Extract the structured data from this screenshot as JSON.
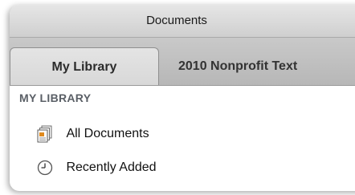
{
  "window": {
    "title": "Documents"
  },
  "tabs": [
    {
      "label": "My Library",
      "active": true
    },
    {
      "label": "2010 Nonprofit Text",
      "active": false
    }
  ],
  "sidebar": {
    "section_title": "MY LIBRARY",
    "items": [
      {
        "label": "All Documents",
        "icon": "documents-icon"
      },
      {
        "label": "Recently Added",
        "icon": "clock-icon"
      }
    ]
  }
}
